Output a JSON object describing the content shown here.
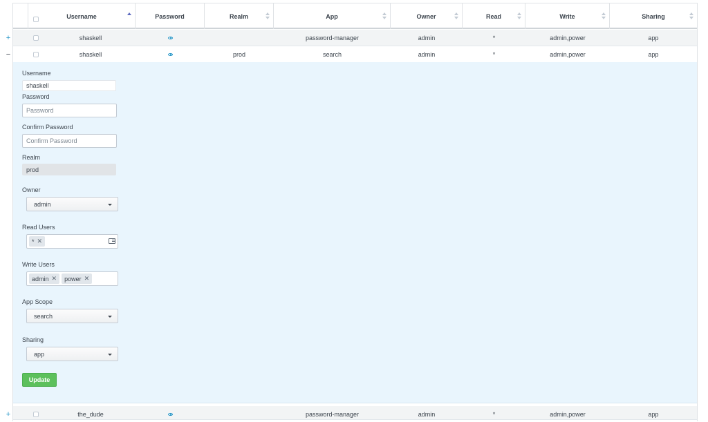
{
  "table": {
    "columns": [
      "Username",
      "Password",
      "Realm",
      "App",
      "Owner",
      "Read",
      "Write",
      "Sharing"
    ],
    "rows": [
      {
        "toggle": "+",
        "username": "shaskell",
        "realm": "",
        "app": "password-manager",
        "owner": "admin",
        "read": "*",
        "write": "admin,power",
        "sharing": "app"
      },
      {
        "toggle": "−",
        "username": "shaskell",
        "realm": "prod",
        "app": "search",
        "owner": "admin",
        "read": "*",
        "write": "admin,power",
        "sharing": "app"
      },
      {
        "toggle": "+",
        "username": "the_dude",
        "realm": "",
        "app": "password-manager",
        "owner": "admin",
        "read": "*",
        "write": "admin,power",
        "sharing": "app"
      }
    ]
  },
  "form": {
    "username_label": "Username",
    "username_value": "shaskell",
    "password_label": "Password",
    "password_placeholder": "Password",
    "confirm_label": "Confirm Password",
    "confirm_placeholder": "Confirm Password",
    "realm_label": "Realm",
    "realm_value": "prod",
    "owner_label": "Owner",
    "owner_value": "admin",
    "read_users_label": "Read Users",
    "read_users": [
      "*"
    ],
    "write_users_label": "Write Users",
    "write_users": [
      "admin",
      "power"
    ],
    "app_scope_label": "App Scope",
    "app_scope_value": "search",
    "sharing_label": "Sharing",
    "sharing_value": "app",
    "update_label": "Update"
  },
  "icons": {
    "remove_chip": "✕",
    "show_password": "eye-icon",
    "sort_indicator": "sort-icon",
    "dropdown": "caret-down-icon",
    "list": "list-icon"
  },
  "colors": {
    "accent": "#1e93c6",
    "expanded_bg": "#e9f5fd",
    "update_button": "#5cc05c",
    "sort_active": "#5c6bc0"
  }
}
